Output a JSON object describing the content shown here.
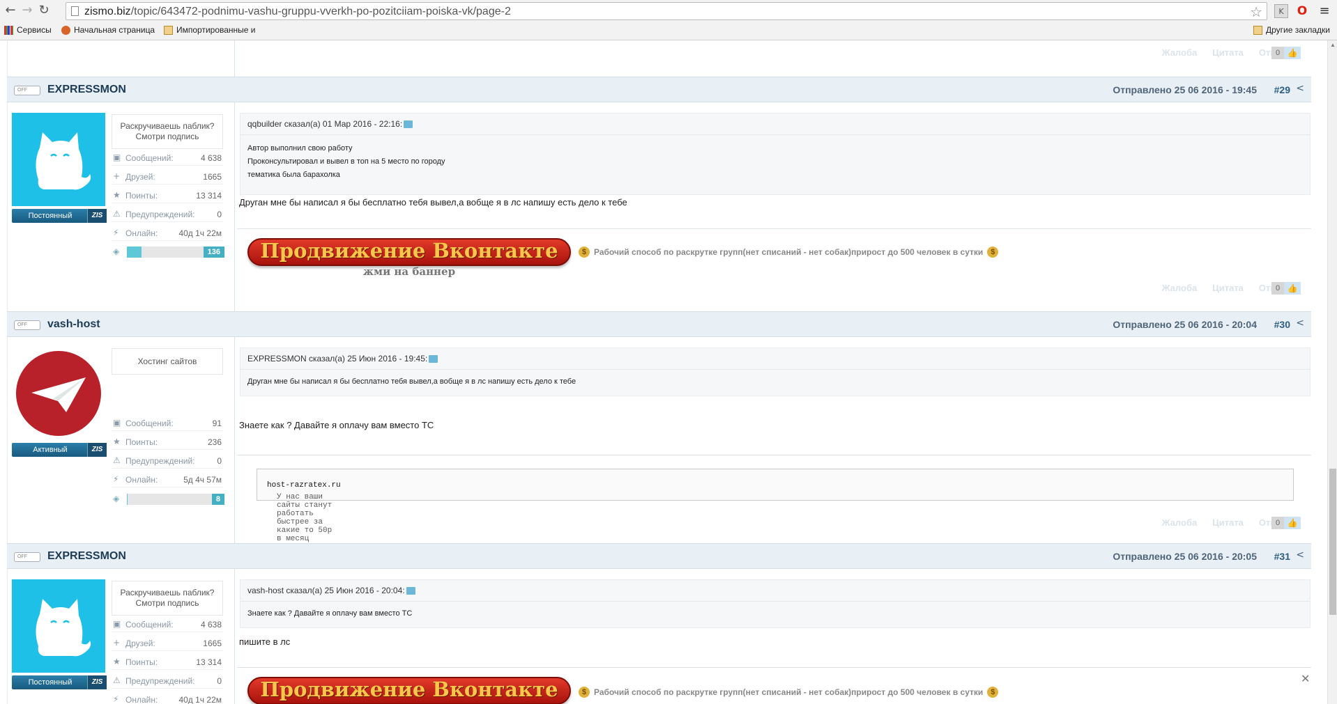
{
  "browser": {
    "url_host": "zismo.biz",
    "url_path": "/topic/643472-podnimu-vashu-gruppu-vverkh-po-pozitciiam-poiska-vk/page-2",
    "bookmarks": [
      "Сервисы",
      "Начальная страница",
      "Импортированные и"
    ],
    "other_bookmarks": "Другие закладки"
  },
  "actions": {
    "complaint": "Жалоба",
    "quote": "Цитата",
    "reply": "Ответить",
    "likes": "0"
  },
  "status_off": "OFF",
  "posts": [
    {
      "author": "EXPRESSMON",
      "posted": "Отправлено 25 06 2016 - 19:45",
      "num": "#29",
      "rank": "Постоянный",
      "zis": "ZIS",
      "signature": "Раскручиваешь паблик? Смотри подпись",
      "stats": [
        {
          "label": "Сообщений:",
          "value": "4 638"
        },
        {
          "label": "Друзей:",
          "value": "1665"
        },
        {
          "label": "Поинты:",
          "value": "13 314"
        },
        {
          "label": "Предупреждений:",
          "value": "0"
        },
        {
          "label": "Онлайн:",
          "value": "40д 1ч 22м"
        }
      ],
      "reputation": "136",
      "reputation_fill": 0.15,
      "quote_header": "qqbuilder сказал(а) 01 Мар 2016 - 22:16:",
      "quote_lines": [
        "Автор выполнил свою работу",
        "Проконсультировал и вывел в топ на 5 место по городу",
        "тематика была барахолка"
      ],
      "text": "Друган мне бы написал я бы бесплатно тебя вывел,а вобще я в лс напишу есть дело к тебе",
      "banner_title": "Продвижение Вконтакте",
      "banner_sub": "жми на баннер",
      "promo": "Рабочий способ по раскрутке групп(нет списаний - нет собак)прирост до 500 человек в сутки"
    },
    {
      "author": "vash-host",
      "posted": "Отправлено 25 06 2016 - 20:04",
      "num": "#30",
      "rank": "Активный",
      "zis": "ZIS",
      "signature": "Хостинг сайтов",
      "stats": [
        {
          "label": "Сообщений:",
          "value": "91"
        },
        {
          "label": "Поинты:",
          "value": "236"
        },
        {
          "label": "Предупреждений:",
          "value": "0"
        },
        {
          "label": "Онлайн:",
          "value": "5д 4ч 57м"
        }
      ],
      "reputation": "8",
      "reputation_fill": 0.01,
      "quote_header": "EXPRESSMON сказал(а) 25 Июн 2016 - 19:45:",
      "quote_lines": [
        "Друган мне бы написал я бы бесплатно тебя вывел,а вобще я в лс напишу есть дело к тебе"
      ],
      "text": "Знаете как ? Давайте я оплачу вам вместо ТС",
      "host_text": "У нас ваши сайты станут работать быстрее за какие то 50р в месяц",
      "host_domain": "host-razratex.ru"
    },
    {
      "author": "EXPRESSMON",
      "posted": "Отправлено 25 06 2016 - 20:05",
      "num": "#31",
      "rank": "Постоянный",
      "zis": "ZIS",
      "signature": "Раскручиваешь паблик? Смотри подпись",
      "stats": [
        {
          "label": "Сообщений:",
          "value": "4 638"
        },
        {
          "label": "Друзей:",
          "value": "1665"
        },
        {
          "label": "Поинты:",
          "value": "13 314"
        },
        {
          "label": "Предупреждений:",
          "value": "0"
        },
        {
          "label": "Онлайн:",
          "value": "40д 1ч 22м"
        }
      ],
      "quote_header": "vash-host сказал(а) 25 Июн 2016 - 20:04:",
      "quote_lines": [
        "Знаете как ? Давайте я оплачу вам вместо ТС"
      ],
      "text": "пишите в лс",
      "banner_title": "Продвижение Вконтакте",
      "promo": "Рабочий способ по раскрутке групп(нет списаний - нет собак)прирост до 500 человек в сутки"
    }
  ]
}
